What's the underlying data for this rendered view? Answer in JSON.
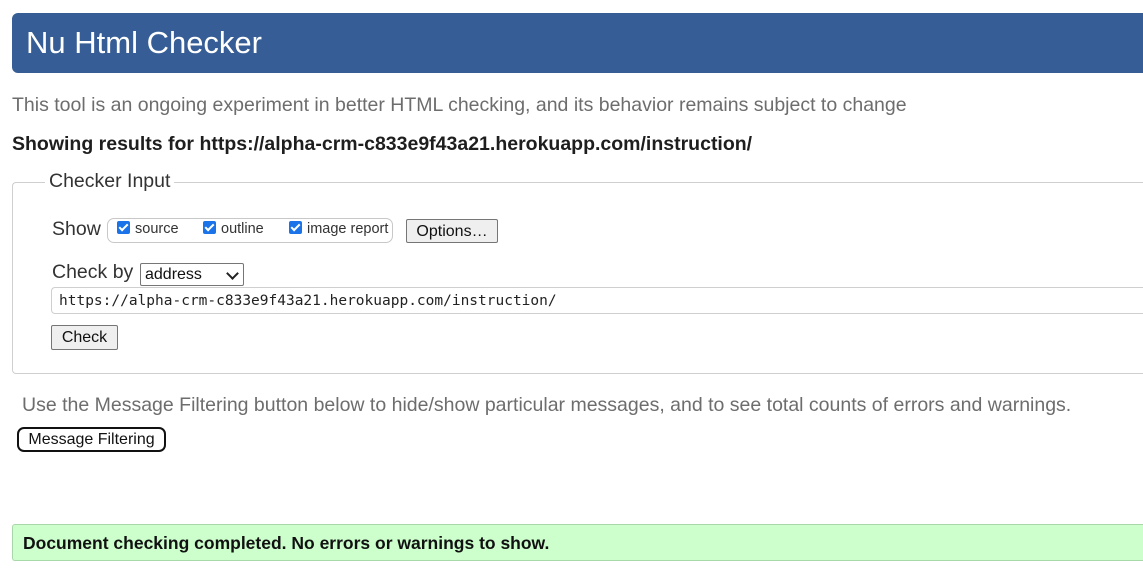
{
  "header": {
    "title": "Nu Html Checker"
  },
  "intro_text": "This tool is an ongoing experiment in better HTML checking, and its behavior remains subject to change",
  "results": {
    "prefix": "Showing results for ",
    "url": "https://alpha-crm-c833e9f43a21.herokuapp.com/instruction/"
  },
  "checker_input": {
    "legend": "Checker Input",
    "show_label": "Show",
    "show_options": [
      {
        "label": "source",
        "checked": true
      },
      {
        "label": "outline",
        "checked": true
      },
      {
        "label": "image report",
        "checked": true
      }
    ],
    "options_button": "Options…",
    "check_by_label": "Check by",
    "check_by_value": "address",
    "url_value": "https://alpha-crm-c833e9f43a21.herokuapp.com/instruction/",
    "check_button": "Check"
  },
  "filtering": {
    "note": "Use the Message Filtering button below to hide/show particular messages, and to see total counts of errors and warnings.",
    "button": "Message Filtering"
  },
  "status": {
    "message": "Document checking completed. No errors or warnings to show."
  },
  "colors": {
    "header_bg": "#365d95",
    "success_bg": "#ccffcc",
    "checkbox": "#1a73e8"
  }
}
